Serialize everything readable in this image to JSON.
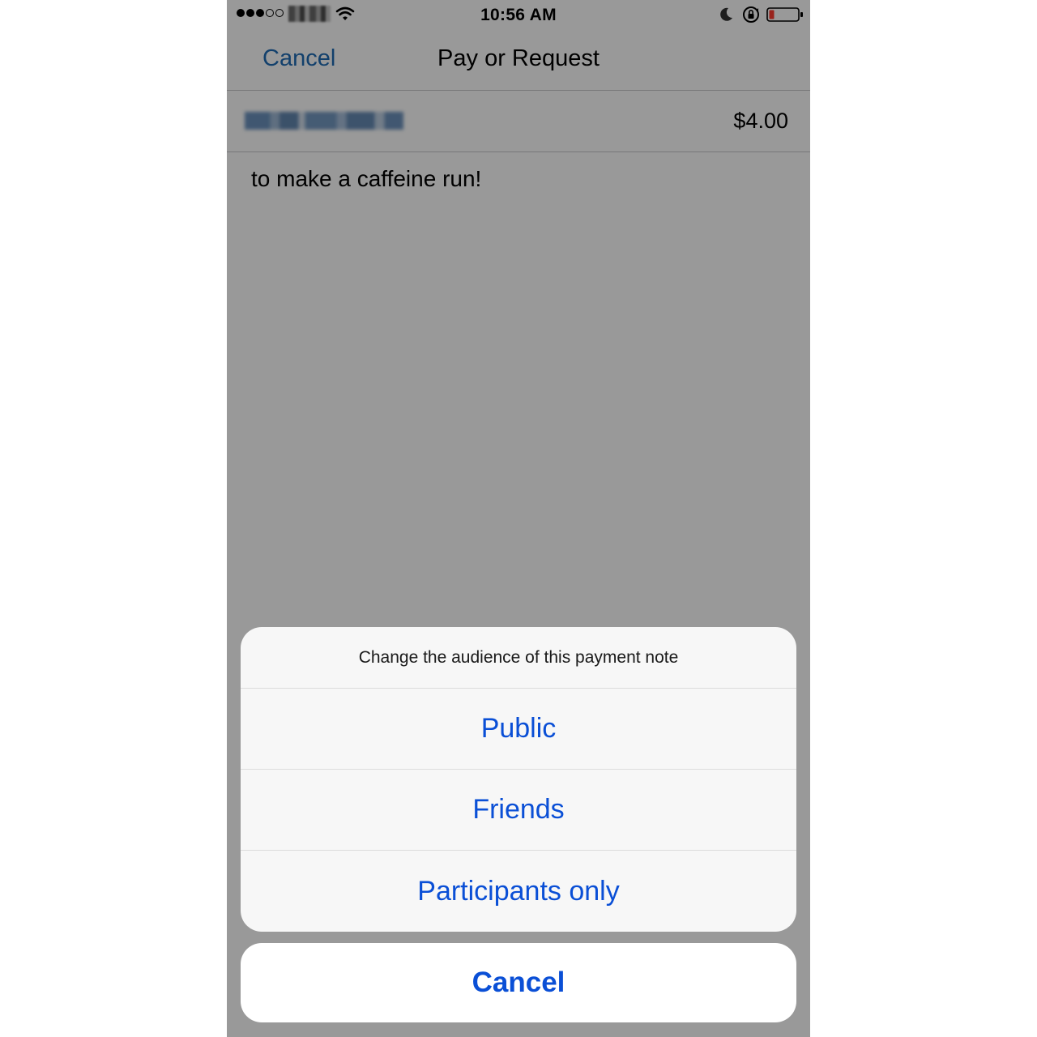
{
  "status_bar": {
    "time": "10:56 AM",
    "signal_icon": "signal-dots-icon",
    "wifi_icon": "wifi-icon",
    "moon_icon": "moon-icon",
    "rotation_lock_icon": "rotation-lock-icon",
    "battery_icon": "battery-icon",
    "battery_color": "#ff3b30"
  },
  "nav_bar": {
    "cancel_label": "Cancel",
    "title": "Pay or Request"
  },
  "payment": {
    "amount": "$4.00",
    "note": "to make a caffeine run!"
  },
  "action_sheet": {
    "title": "Change the audience of this payment note",
    "options": [
      {
        "label": "Public"
      },
      {
        "label": "Friends"
      },
      {
        "label": "Participants only"
      }
    ],
    "cancel_label": "Cancel"
  },
  "colors": {
    "accent": "#0a4fd6",
    "nav_link": "#1f6bb5"
  }
}
